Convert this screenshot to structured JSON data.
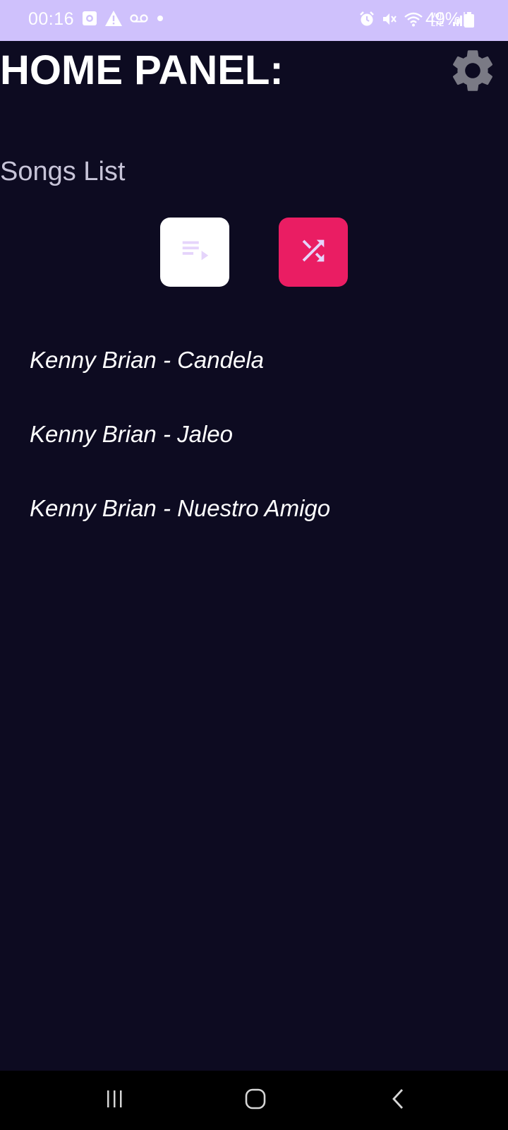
{
  "status_bar": {
    "time": "00:16",
    "battery": "49%",
    "left_icons": [
      "screen-record-icon",
      "warning-icon",
      "voicemail-icon",
      "dot-icon"
    ],
    "right_icons": [
      "alarm-icon",
      "mute-icon",
      "wifi-icon",
      "volte-icon",
      "signal-icon",
      "battery-icon"
    ],
    "volte_label": "Vo)) LTE"
  },
  "header": {
    "title": "HOME PANEL:",
    "settings_icon": "gear-icon"
  },
  "songs": {
    "heading": "Songs List",
    "play_all_icon": "playlist-play-icon",
    "shuffle_icon": "shuffle-icon",
    "items": [
      {
        "label": "Kenny Brian - Candela"
      },
      {
        "label": "Kenny Brian - Jaleo"
      },
      {
        "label": "Kenny Brian - Nuestro Amigo"
      }
    ]
  },
  "colors": {
    "background": "#0d0b21",
    "status_bar": "#cfc1fc",
    "shuffle_button": "#ea1d63",
    "play_button": "#ffffff",
    "icon_tint": "#e5d4fb",
    "settings_icon": "#7a7a85"
  },
  "nav_bar": {
    "icons": [
      "recent-apps-icon",
      "home-icon",
      "back-icon"
    ]
  }
}
